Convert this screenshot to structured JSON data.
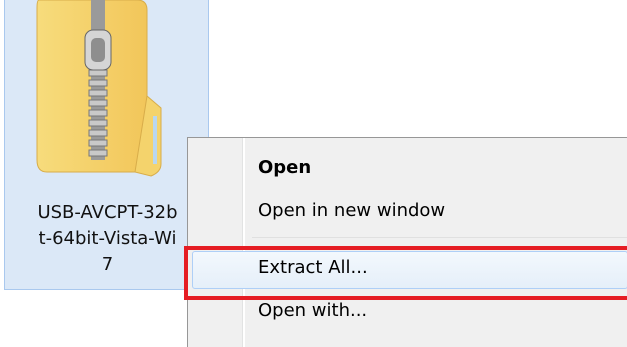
{
  "file": {
    "label": "USB-AVCPT-32b\nt-64bit-Vista-Wi\n7",
    "icon": "zip-folder-icon"
  },
  "context_menu": {
    "items": [
      {
        "label": "Open",
        "bold": true
      },
      {
        "label": "Open in new window"
      },
      {
        "label": "Extract All..."
      },
      {
        "label": "Open with..."
      }
    ]
  },
  "colors": {
    "highlight": "#e51c23",
    "selection": "#dbe8f7"
  }
}
